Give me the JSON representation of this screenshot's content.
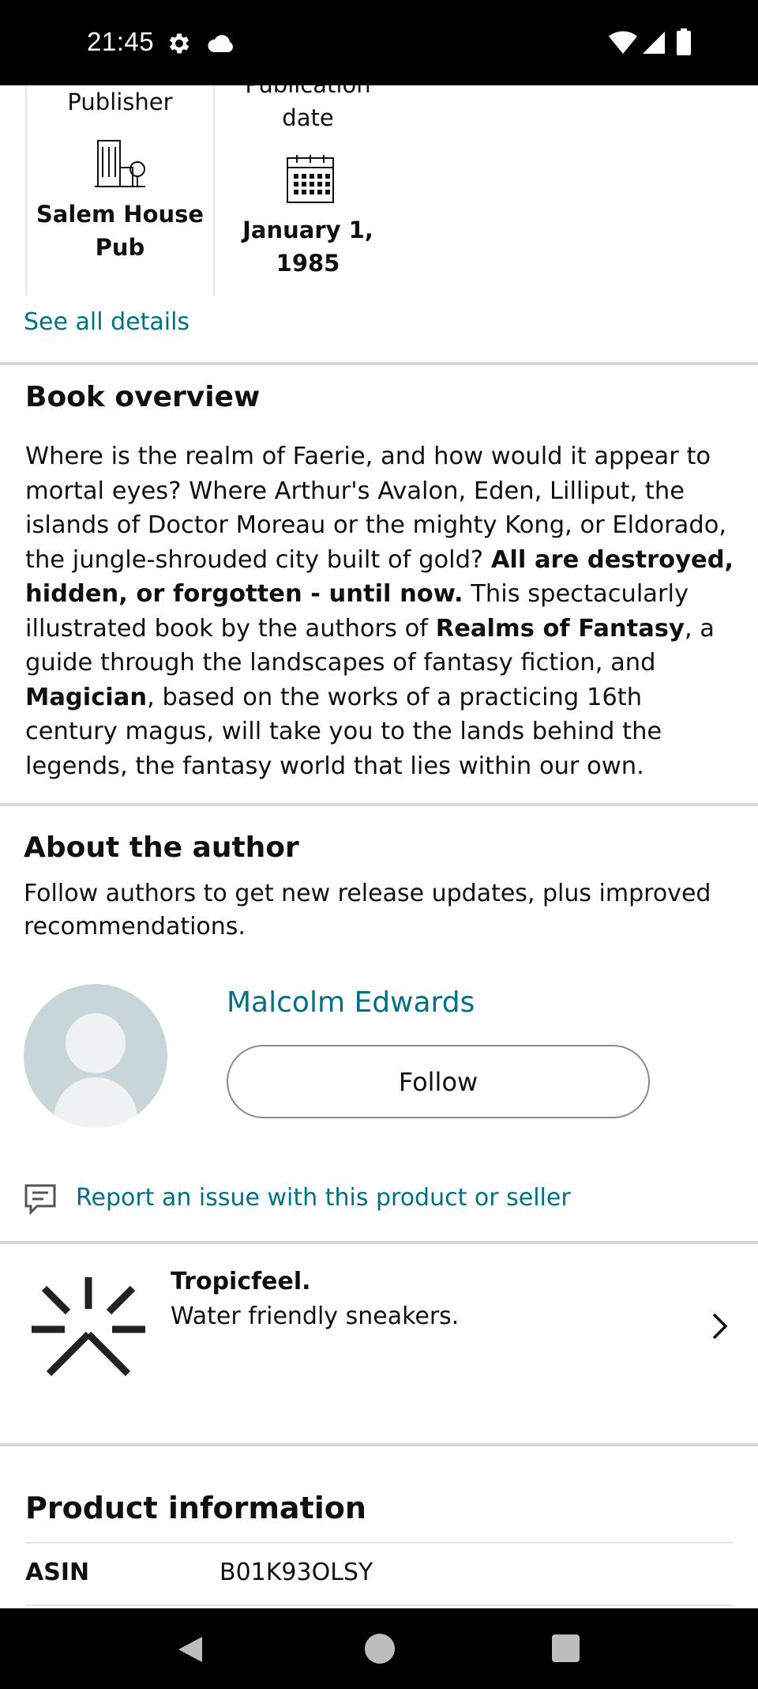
{
  "status_bar": {
    "time": "21:45",
    "icons": [
      "gear-icon",
      "cloud-icon",
      "wifi-icon",
      "signal-icon",
      "battery-icon"
    ]
  },
  "details": {
    "columns": [
      {
        "label": "Publisher",
        "icon": "building-icon",
        "value_line1": "Salem House",
        "value_line2": "Pub"
      },
      {
        "label_line1": "Publication",
        "label_line2": "date",
        "icon": "calendar-icon",
        "value_line1": "January 1,",
        "value_line2": "1985"
      }
    ],
    "see_all": "See all details"
  },
  "overview": {
    "title": "Book overview",
    "p1": "Where is the realm of Faerie, and how would it appear to mortal eyes? Where Arthur's Avalon, Eden, Lilliput, the islands of Doctor Moreau or the mighty Kong, or Eldorado, the jungle-shrouded city built of gold? ",
    "b1": "All are destroyed, hidden, or forgotten - until now.",
    "p2": " This spectacularly illustrated book by the authors of ",
    "b2": "Realms of Fantasy",
    "p3": ", a guide through the landscapes of fantasy fiction, and ",
    "b3": "Magician",
    "p4": ", based on the works of a practicing 16th century magus, will take you to the lands behind the legends, the fantasy world that lies within our own."
  },
  "author": {
    "title": "About the author",
    "subtitle": "Follow authors to get new release updates, plus improved recommendations.",
    "name": "Malcolm Edwards",
    "follow_label": "Follow"
  },
  "report": {
    "label": "Report an issue with this product or seller"
  },
  "ad": {
    "brand": "Tropicfeel.",
    "tagline": "Water friendly sneakers."
  },
  "product_info": {
    "title": "Product information",
    "rows": [
      {
        "key": "ASIN",
        "value": "B01K93OLSY"
      }
    ]
  },
  "colors": {
    "link": "#007185",
    "text": "#0f1111",
    "divider": "#d5d9d9"
  }
}
